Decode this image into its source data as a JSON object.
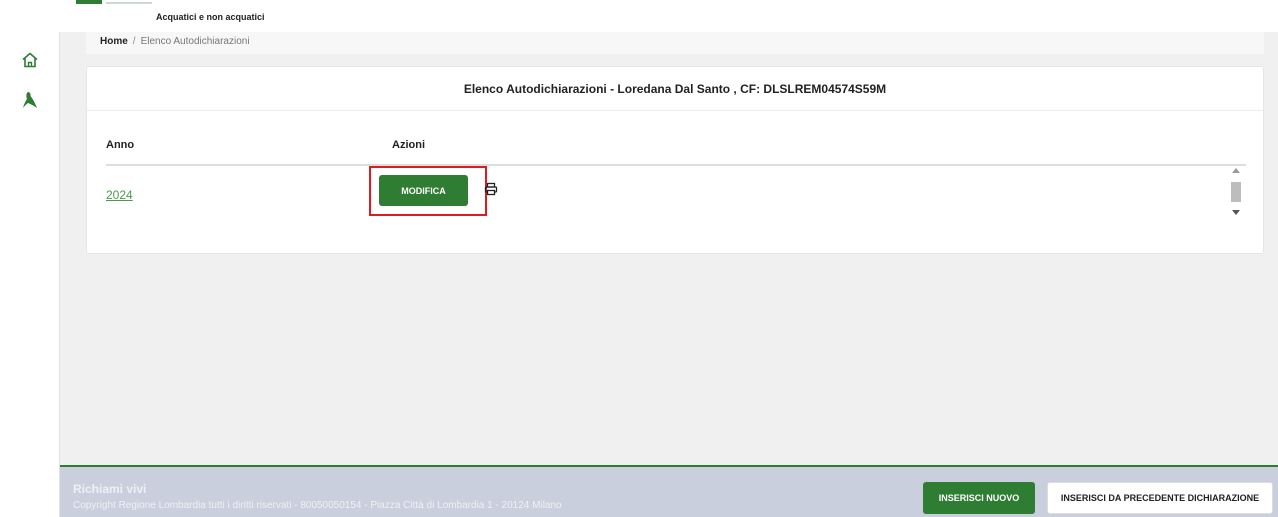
{
  "header": {
    "subtitle": "Acquatici e non acquatici"
  },
  "sidebar": {
    "items": [
      {
        "icon": "home-icon"
      },
      {
        "icon": "bird-icon"
      }
    ]
  },
  "breadcrumb": {
    "home": "Home",
    "separator": "/",
    "current": "Elenco Autodichiarazioni"
  },
  "card": {
    "title": "Elenco Autodichiarazioni - Loredana Dal Santo , CF: DLSLREM04574S59M",
    "columns": [
      "Anno",
      "Azioni"
    ],
    "rows": [
      {
        "anno": "2024",
        "action_label": "MODIFICA",
        "print_icon": "printer-icon"
      }
    ]
  },
  "footer": {
    "title": "Richiami vivi",
    "copyright": "Copyright Regione Lombardia tutti i diritti riservati - 80050050154 - Piazza Città di Lombardia 1 - 20124 Milano",
    "btn_nuovo": "INSERISCI NUOVO",
    "btn_precedente": "INSERISCI DA PRECEDENTE DICHIARAZIONE"
  },
  "colors": {
    "primary_green": "#2e7d32",
    "link_green": "#4a9a4a",
    "highlight_red": "#e01b1b",
    "footer_bg": "#c9cfdd"
  }
}
